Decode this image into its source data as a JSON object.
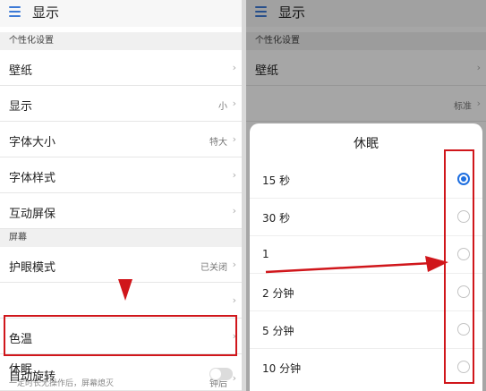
{
  "left": {
    "title": "显示",
    "sections": {
      "personal": "个性化设置",
      "screen": "屏幕"
    },
    "rows": {
      "wallpaper": {
        "label": "壁纸"
      },
      "display_size": {
        "label": "显示",
        "value": "小"
      },
      "font_size": {
        "label": "字体大小",
        "value": "特大"
      },
      "font_style": {
        "label": "字体样式"
      },
      "screensaver": {
        "label": "互动屏保"
      },
      "eye_mode": {
        "label": "护眼模式",
        "value": "已关闭"
      },
      "color_temp": {
        "label": "色温"
      },
      "sleep": {
        "label": "休眠",
        "sub": "一定时长无操作后，屏幕熄灭",
        "value": "钟后"
      },
      "auto_rotate": {
        "label": "自动旋转",
        "enabled": false
      }
    },
    "chevron": "›"
  },
  "right": {
    "title": "显示",
    "section": "个性化设置",
    "wallpaper": "壁纸",
    "display_value": "标准",
    "chevron": "›",
    "dialog": {
      "title": "休眠",
      "options": [
        {
          "label": "15 秒",
          "selected": true
        },
        {
          "label": "30 秒",
          "selected": false
        },
        {
          "label": "1",
          "selected": false
        },
        {
          "label": "2 分钟",
          "selected": false
        },
        {
          "label": "5 分钟",
          "selected": false
        },
        {
          "label": "10 分钟",
          "selected": false
        }
      ]
    }
  },
  "colors": {
    "accent": "#1f6fe0",
    "highlight": "#d0161b"
  }
}
